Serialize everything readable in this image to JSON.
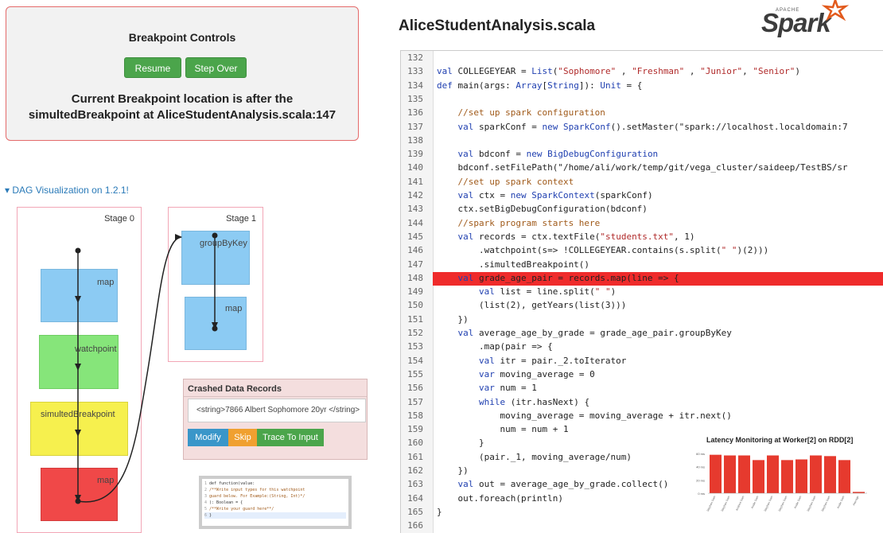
{
  "breakpoint": {
    "title": "Breakpoint Controls",
    "resume_label": "Resume",
    "step_over_label": "Step Over",
    "message_line1": "Current Breakpoint location is after the",
    "message_line2": "simultedBreakpoint at AliceStudentAnalysis.scala:147"
  },
  "dag": {
    "link_label": "▾ DAG Visualization on 1.2.1!",
    "stage0": {
      "label": "Stage 0",
      "nodes": [
        "map",
        "watchpoint",
        "simultedBreakpoint",
        "map"
      ]
    },
    "stage1": {
      "label": "Stage 1",
      "nodes": [
        "groupByKey",
        "map"
      ]
    }
  },
  "crashed": {
    "title": "Crashed Data Records",
    "record": "<string>7866 Albert Sophomore 20yr </string>",
    "modify_label": "Modify",
    "skip_label": "Skip",
    "trace_label": "Trace To Input"
  },
  "guard_code": [
    "def function(value:",
    "/**Write input types for this watchpoint",
    "guard below. For Example:(String, Int)*/",
    "): Boolean = {",
    "/**Write your guard here**/",
    "}"
  ],
  "editor": {
    "filename": "AliceStudentAnalysis.scala",
    "logo_small": "APACHE",
    "logo_text": "Spark",
    "highlight_line": 148,
    "lines": [
      {
        "n": "132",
        "t": ""
      },
      {
        "n": "133",
        "t": "val COLLEGEYEAR = List(\"Sophomore\" , \"Freshman\" , \"Junior\", \"Senior\")"
      },
      {
        "n": "134",
        "t": "def main(args: Array[String]): Unit = {"
      },
      {
        "n": "135",
        "t": ""
      },
      {
        "n": "136",
        "t": "    //set up spark configuration"
      },
      {
        "n": "137",
        "t": "    val sparkConf = new SparkConf().setMaster(\"spark://localhost.localdomain:7"
      },
      {
        "n": "138",
        "t": ""
      },
      {
        "n": "139",
        "t": "    val bdconf = new BigDebugConfiguration"
      },
      {
        "n": "140",
        "t": "    bdconf.setFilePath(\"/home/ali/work/temp/git/vega_cluster/saideep/TestBS/sr"
      },
      {
        "n": "141",
        "t": "    //set up spark context"
      },
      {
        "n": "142",
        "t": "    val ctx = new SparkContext(sparkConf)"
      },
      {
        "n": "143",
        "t": "    ctx.setBigDebugConfiguration(bdconf)"
      },
      {
        "n": "144",
        "t": "    //spark program starts here"
      },
      {
        "n": "145",
        "t": "    val records = ctx.textFile(\"students.txt\", 1)"
      },
      {
        "n": "146",
        "t": "        .watchpoint(s=> !COLLEGEYEAR.contains(s.split(\" \")(2)))"
      },
      {
        "n": "147",
        "t": "        .simultedBreakpoint()"
      },
      {
        "n": "148",
        "t": "    val grade_age_pair = records.map(line => {"
      },
      {
        "n": "149",
        "t": "        val list = line.split(\" \")"
      },
      {
        "n": "150",
        "t": "        (list(2), getYears(list(3)))"
      },
      {
        "n": "151",
        "t": "    })"
      },
      {
        "n": "152",
        "t": "    val average_age_by_grade = grade_age_pair.groupByKey"
      },
      {
        "n": "153",
        "t": "        .map(pair => {"
      },
      {
        "n": "154",
        "t": "        val itr = pair._2.toIterator"
      },
      {
        "n": "155",
        "t": "        var moving_average = 0"
      },
      {
        "n": "156",
        "t": "        var num = 1"
      },
      {
        "n": "157",
        "t": "        while (itr.hasNext) {"
      },
      {
        "n": "158",
        "t": "            moving_average = moving_average + itr.next()"
      },
      {
        "n": "159",
        "t": "            num = num + 1"
      },
      {
        "n": "160",
        "t": "        }"
      },
      {
        "n": "161",
        "t": "        (pair._1, moving_average/num)"
      },
      {
        "n": "162",
        "t": "    })"
      },
      {
        "n": "163",
        "t": "    val out = average_age_by_grade.collect()"
      },
      {
        "n": "164",
        "t": "    out.foreach(println)"
      },
      {
        "n": "165",
        "t": "}"
      },
      {
        "n": "166",
        "t": ""
      }
    ]
  },
  "latency": {
    "title": "Latency Monitoring at Worker[2] on RDD[2]",
    "y_ticks": [
      "60 ms",
      "40 ms",
      "20 ms",
      "0 ms"
    ],
    "bar_color": "#e63a2e",
    "values": [
      58,
      57,
      57,
      50,
      57,
      50,
      51,
      57,
      56,
      50,
      2
    ],
    "x_labels": [
      "Stephan Sam",
      "Stephan Sam",
      "Andrew Sam",
      "Andie Sam",
      "Stephan Sam",
      "Stephan Sam",
      "Andie Sam",
      "Stephan Sam",
      "Stephan Sam",
      "Andie Sam",
      "Average"
    ]
  }
}
